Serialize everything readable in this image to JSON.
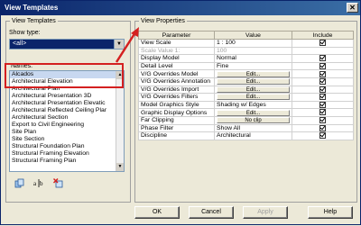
{
  "window": {
    "title": "View Templates",
    "close_glyph": "✕"
  },
  "view_templates": {
    "legend": "View Templates",
    "show_type_label": "Show type:",
    "show_type_value": "<all>",
    "names_label": "Names:",
    "names": [
      "Alcados",
      "Architectural Elevation",
      "Architectural Plan",
      "Architectural Presentation 3D",
      "Architectural Presentation Elevatic",
      "Architectural Reflected Ceiling Plar",
      "Architectural Section",
      "Export to Civil Engineering",
      "Site Plan",
      "Site Section",
      "Structural Foundation Plan",
      "Structural Framing Elevation",
      "Structural Framing Plan"
    ],
    "selected_index": 0,
    "icons": [
      "duplicate-icon",
      "rename-icon",
      "delete-icon"
    ]
  },
  "view_properties": {
    "legend": "View Properties",
    "headers": {
      "parameter": "Parameter",
      "value": "Value",
      "include": "Include"
    },
    "rows": [
      {
        "param": "View Scale",
        "value": "1 : 100",
        "button": false,
        "include": true,
        "dim": false
      },
      {
        "param": "Scale Value  1:",
        "value": "100",
        "button": false,
        "include": false,
        "dim": true
      },
      {
        "param": "Display Model",
        "value": "Normal",
        "button": false,
        "include": true,
        "dim": false
      },
      {
        "param": "Detail Level",
        "value": "Fine",
        "button": false,
        "include": true,
        "dim": false
      },
      {
        "param": "V/G Overrides Model",
        "value": "Edit...",
        "button": true,
        "include": true,
        "dim": false
      },
      {
        "param": "V/G Overrides Annotation",
        "value": "Edit...",
        "button": true,
        "include": true,
        "dim": false
      },
      {
        "param": "V/G Overrides Import",
        "value": "Edit...",
        "button": true,
        "include": true,
        "dim": false
      },
      {
        "param": "V/G Overrides Filters",
        "value": "Edit...",
        "button": true,
        "include": true,
        "dim": false
      },
      {
        "param": "Model Graphics Style",
        "value": "Shading w/ Edges",
        "button": false,
        "include": true,
        "dim": false
      },
      {
        "param": "Graphic Display Options",
        "value": "Edit...",
        "button": true,
        "include": true,
        "dim": false
      },
      {
        "param": "Far Clipping",
        "value": "No clip",
        "button": true,
        "include": true,
        "dim": false
      },
      {
        "param": "Phase Filter",
        "value": "Show All",
        "button": false,
        "include": true,
        "dim": false
      },
      {
        "param": "Discipline",
        "value": "Architectural",
        "button": false,
        "include": true,
        "dim": false
      }
    ]
  },
  "buttons": {
    "ok": "OK",
    "cancel": "Cancel",
    "apply": "Apply",
    "help": "Help"
  },
  "colors": {
    "annotation_red": "#d42020",
    "titlebar": "#0a246a"
  }
}
